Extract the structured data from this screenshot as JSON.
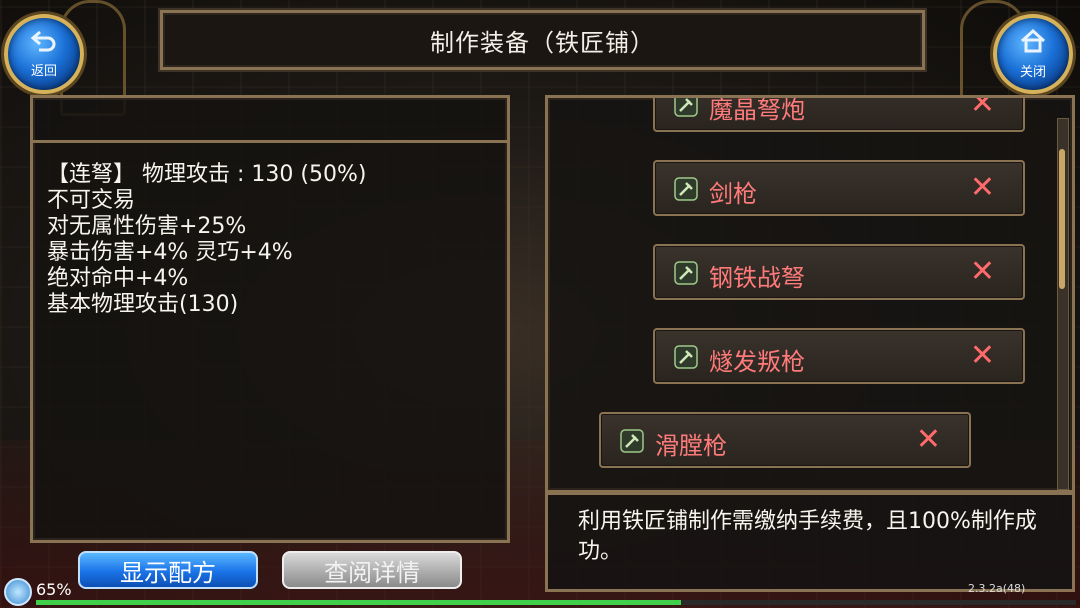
{
  "header": {
    "title": "制作装备（铁匠铺）",
    "back_label": "返回",
    "back_icon": "undo-arrow-icon",
    "close_label": "关闭",
    "close_icon": "home-icon"
  },
  "info": {
    "lines": [
      "【连弩】 物理攻击 :  130 (50%)",
      "不可交易",
      "对无属性伤害+25%",
      "暴击伤害+4% 灵巧+4%",
      "绝对命中+4%",
      "基本物理攻击(130)"
    ]
  },
  "buttons": {
    "show_recipe": "显示配方",
    "view_details": "查阅详情"
  },
  "recipes": {
    "items": [
      {
        "name": "魔晶弩炮",
        "icon": "wrench-hammer-icon",
        "remove": "✕"
      },
      {
        "name": "剑枪",
        "icon": "wrench-hammer-icon",
        "remove": "✕"
      },
      {
        "name": "钢铁战弩",
        "icon": "wrench-hammer-icon",
        "remove": "✕"
      },
      {
        "name": "燧发叛枪",
        "icon": "wrench-hammer-icon",
        "remove": "✕"
      },
      {
        "name": "滑膛枪",
        "icon": "wrench-hammer-icon",
        "remove": "✕",
        "selected": true
      }
    ]
  },
  "notice": {
    "text": "利用铁匠铺制作需缴纳手续费，且100%制作成功。"
  },
  "status": {
    "battery": "65%",
    "progress": 0.62,
    "version": "2.3.2a(48)"
  },
  "colors": {
    "accent_red": "#ff7a7a",
    "frame_gold": "#8a7352",
    "button_blue": "#1a73e8"
  }
}
